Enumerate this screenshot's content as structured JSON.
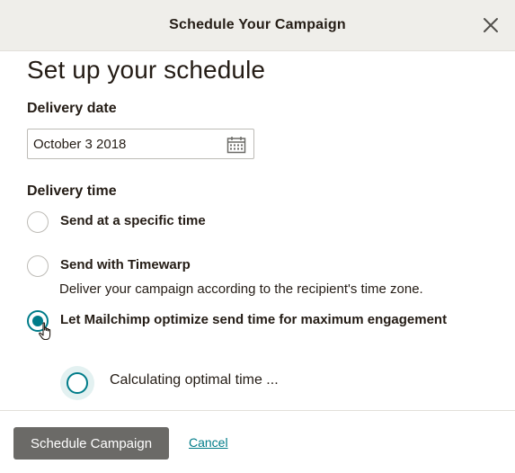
{
  "modal": {
    "title": "Schedule Your Campaign",
    "close_icon": "close-icon"
  },
  "content": {
    "heading": "Set up your schedule",
    "delivery_date": {
      "label": "Delivery date",
      "value": "October 3 2018",
      "icon": "calendar-icon"
    },
    "delivery_time": {
      "label": "Delivery time",
      "options": [
        {
          "label": "Send at a specific time",
          "selected": false
        },
        {
          "label": "Send with Timewarp",
          "selected": false,
          "description": "Deliver your campaign according to the recipient's time zone."
        },
        {
          "label": "Let Mailchimp optimize send time for maximum engagement",
          "selected": true
        }
      ]
    },
    "status": {
      "text": "Calculating optimal time ...",
      "icon": "loading-spinner-icon"
    }
  },
  "footer": {
    "primary_label": "Schedule Campaign",
    "cancel_label": "Cancel"
  },
  "colors": {
    "accent": "#007c89",
    "header_bg": "#efeeea",
    "button_bg": "#6b6a67",
    "text": "#241c15"
  }
}
